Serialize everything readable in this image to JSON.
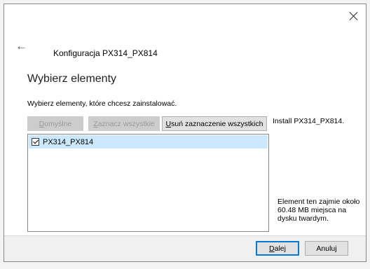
{
  "window": {
    "title": "Konfiguracja PX314_PX814",
    "close_icon": "close-icon",
    "back_icon": "back-arrow-icon"
  },
  "page": {
    "heading": "Wybierz elementy",
    "subtitle": "Wybierz elementy, które chcesz zainstalować."
  },
  "buttons": {
    "defaults": {
      "first": "D",
      "rest": "omyślne",
      "enabled": false
    },
    "select_all": {
      "first": "Z",
      "rest": "aznacz wszystkie",
      "enabled": false
    },
    "deselect_all": {
      "first": "U",
      "rest": "suń zaznaczenie wszystkich",
      "enabled": true
    }
  },
  "list": {
    "items": [
      {
        "label": "PX314_PX814",
        "checked": true,
        "selected": true
      }
    ]
  },
  "description": {
    "top": "Install PX314_PX814.",
    "bottom": "Element ten zajmie około 60.48 MB miejsca na dysku twardym."
  },
  "footer": {
    "next": {
      "first": "D",
      "rest": "alej"
    },
    "cancel": "Anuluj"
  },
  "colors": {
    "selection": "#cce8ff",
    "accent": "#0078d7"
  }
}
